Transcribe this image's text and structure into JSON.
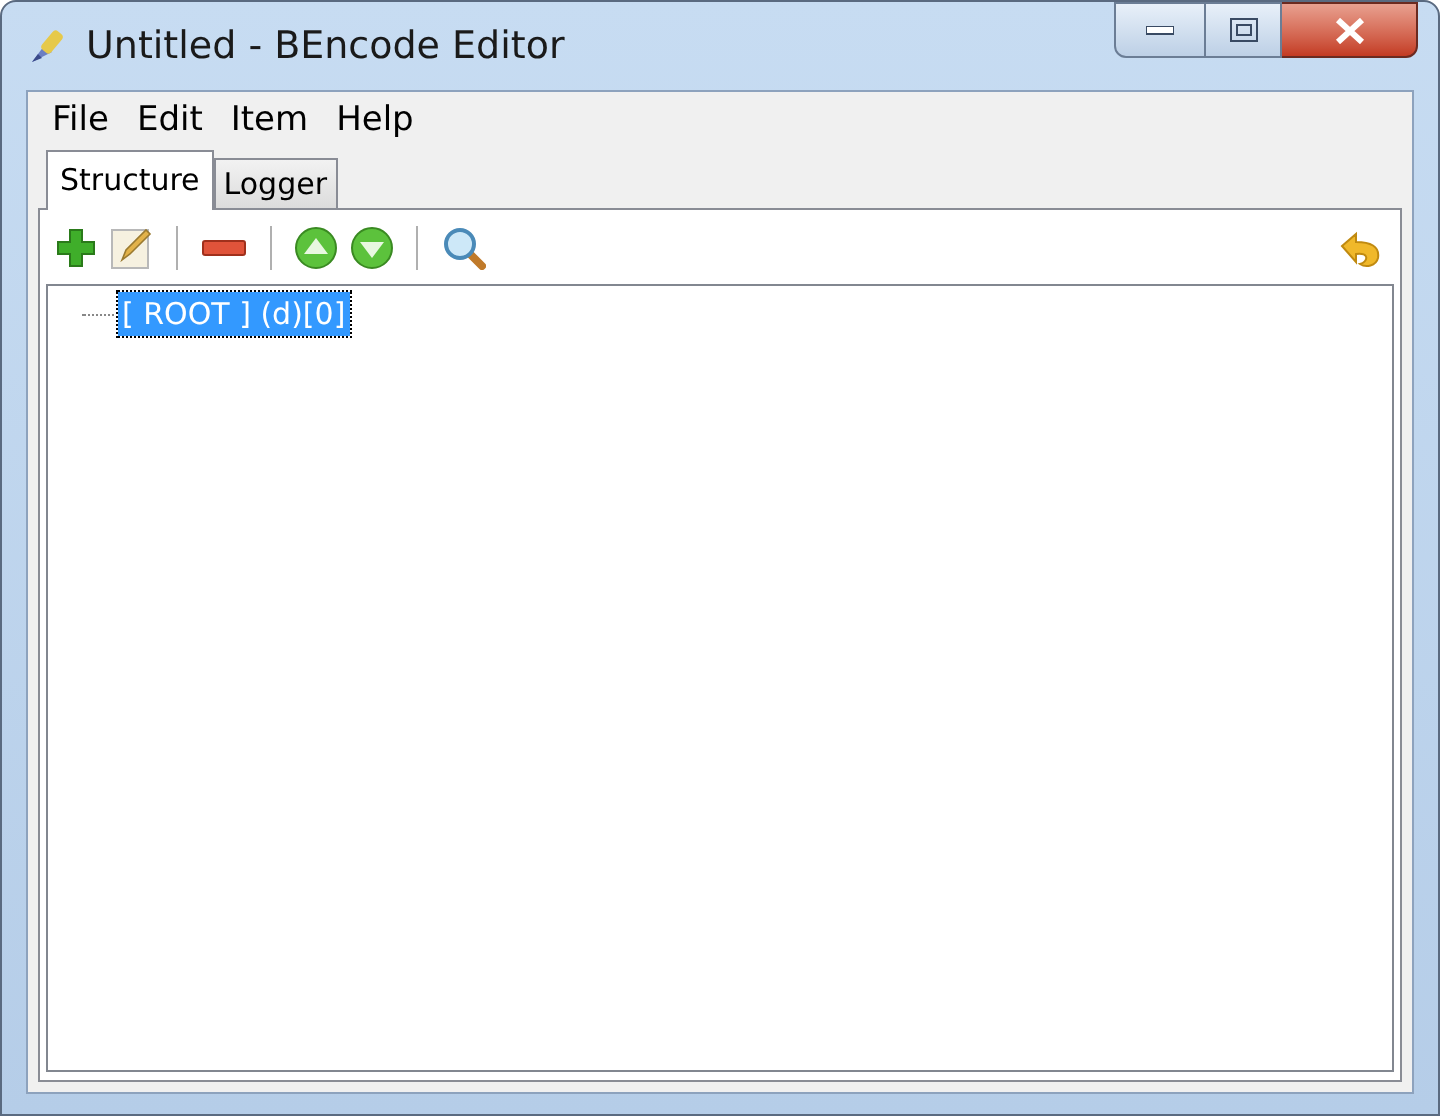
{
  "window": {
    "title": "Untitled - BEncode Editor"
  },
  "menu": [
    {
      "label": "File"
    },
    {
      "label": "Edit"
    },
    {
      "label": "Item"
    },
    {
      "label": "Help"
    }
  ],
  "tabs": [
    {
      "label": "Structure",
      "selected": true
    },
    {
      "label": "Logger",
      "selected": false
    }
  ],
  "tree": [
    {
      "label": "[ ROOT ] (d)[0]",
      "selected": true
    }
  ]
}
